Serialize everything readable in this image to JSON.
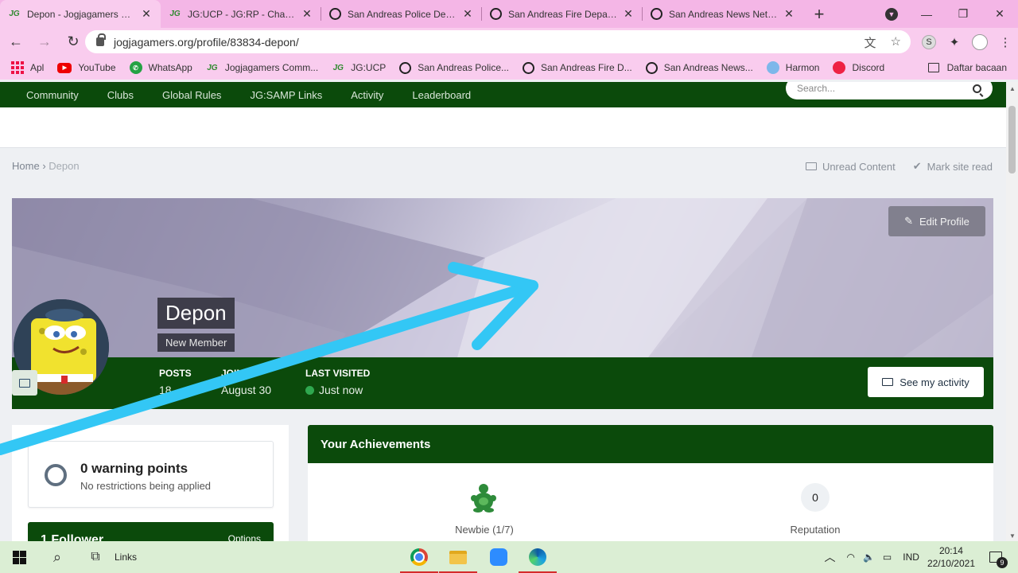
{
  "browser": {
    "tabs": [
      {
        "title": "Depon - Jogjagamers Community",
        "icon": "jg-logo-icon",
        "active": true
      },
      {
        "title": "JG:UCP - JG:RP - Character",
        "icon": "jg-logo-icon",
        "active": false
      },
      {
        "title": "San Andreas Police Department",
        "icon": "globe-icon",
        "active": false
      },
      {
        "title": "San Andreas Fire Department",
        "icon": "globe-icon",
        "active": false
      },
      {
        "title": "San Andreas News Network",
        "icon": "globe-icon",
        "active": false
      }
    ],
    "url": "jogjagamers.org/profile/83834-depon/",
    "profile_letter": "S",
    "bookmarks": [
      {
        "label": "Apl",
        "icon": "apps-icon"
      },
      {
        "label": "YouTube",
        "icon": "youtube-icon"
      },
      {
        "label": "WhatsApp",
        "icon": "whatsapp-icon"
      },
      {
        "label": "Jogjagamers Comm...",
        "icon": "jg-logo-icon"
      },
      {
        "label": "JG:UCP",
        "icon": "jg-logo-icon"
      },
      {
        "label": "San Andreas Police...",
        "icon": "globe-icon"
      },
      {
        "label": "San Andreas Fire D...",
        "icon": "globe-icon"
      },
      {
        "label": "San Andreas News...",
        "icon": "globe-icon"
      },
      {
        "label": "Harmon",
        "icon": "harmon-icon"
      },
      {
        "label": "Discord",
        "icon": "discord-icon"
      }
    ],
    "reading_list": "Daftar bacaan"
  },
  "site": {
    "nav": [
      "Community",
      "Clubs",
      "Global Rules",
      "JG:SAMP Links",
      "Activity",
      "Leaderboard"
    ],
    "search_placeholder": "Search...",
    "breadcrumb": {
      "home": "Home",
      "current": "Depon"
    },
    "unread": "Unread Content",
    "mark_read": "Mark site read"
  },
  "profile": {
    "name": "Depon",
    "group": "New Member",
    "edit_label": "Edit Profile",
    "stats": [
      {
        "label": "POSTS",
        "value": "18"
      },
      {
        "label": "JOINED",
        "value": "August 30"
      },
      {
        "label": "LAST VISITED",
        "value": "Just now"
      }
    ],
    "activity_label": "See my activity",
    "warning": {
      "title": "0 warning points",
      "subtitle": "No restrictions being applied"
    },
    "followers": {
      "title": "1 Follower",
      "options": "Options"
    },
    "achievements": {
      "title": "Your Achievements",
      "badge_label": "Newbie (1/7)",
      "reputation_value": "0",
      "reputation_label": "Reputation"
    }
  },
  "taskbar": {
    "links_label": "Links",
    "language": "IND",
    "time": "20:14",
    "date": "22/10/2021",
    "notifications": "9"
  },
  "colors": {
    "accent_green": "#0b4a0b",
    "browser_pink": "#f4b6e6",
    "annotation_arrow": "#33c7f5"
  }
}
